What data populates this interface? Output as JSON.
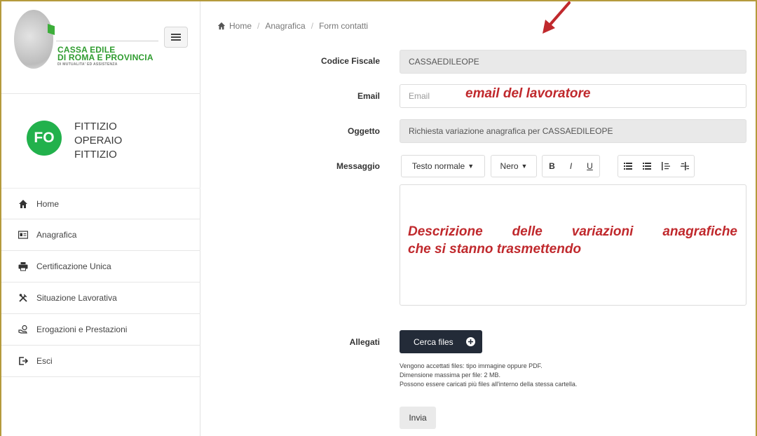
{
  "logo": {
    "line1": "CASSA EDILE",
    "line2": "DI ROMA E PROVINCIA",
    "line3": "DI MUTUALITA' ED ASSISTENZA"
  },
  "user": {
    "initials": "FO",
    "name_lines": [
      "FITTIZIO",
      "OPERAIO",
      "FITTIZIO"
    ]
  },
  "sidebar": {
    "items": [
      {
        "label": "Home",
        "icon": "home-icon"
      },
      {
        "label": "Anagrafica",
        "icon": "id-card-icon"
      },
      {
        "label": "Certificazione Unica",
        "icon": "printer-icon"
      },
      {
        "label": "Situazione Lavorativa",
        "icon": "tools-icon"
      },
      {
        "label": "Erogazioni e Prestazioni",
        "icon": "hand-coin-icon"
      },
      {
        "label": "Esci",
        "icon": "sign-out-icon"
      }
    ]
  },
  "breadcrumb": [
    "Home",
    "Anagrafica",
    "Form contatti"
  ],
  "form": {
    "codice_fiscale": {
      "label": "Codice Fiscale",
      "value": "CASSAEDILEOPE"
    },
    "email": {
      "label": "Email",
      "placeholder": "Email"
    },
    "oggetto": {
      "label": "Oggetto",
      "value": "Richiesta variazione anagrafica per CASSAEDILEOPE"
    },
    "messaggio": {
      "label": "Messaggio"
    },
    "allegati": {
      "label": "Allegati"
    }
  },
  "editor_toolbar": {
    "style_select": "Testo normale",
    "color_select": "Nero",
    "bold": "B",
    "italic": "I",
    "underline": "U"
  },
  "annotations": {
    "email_note": "email del lavoratore",
    "message_note_line1": "Descrizione delle variazioni anagrafiche",
    "message_note_line2": "che si stanno trasmettendo",
    "accent_color": "#c0292d"
  },
  "upload": {
    "button_label": "Cerca files",
    "help": [
      "Vengono accettati files: tipo immagine oppure PDF.",
      "Dimensione massima per file: 2 MB.",
      "Possono essere caricati più files all'interno della stessa cartella."
    ]
  },
  "submit_label": "Invia",
  "colors": {
    "brand_green": "#2f9c2f",
    "avatar_green": "#22b14c",
    "dark_button": "#232b38",
    "frame_gold": "#b59a3c"
  }
}
